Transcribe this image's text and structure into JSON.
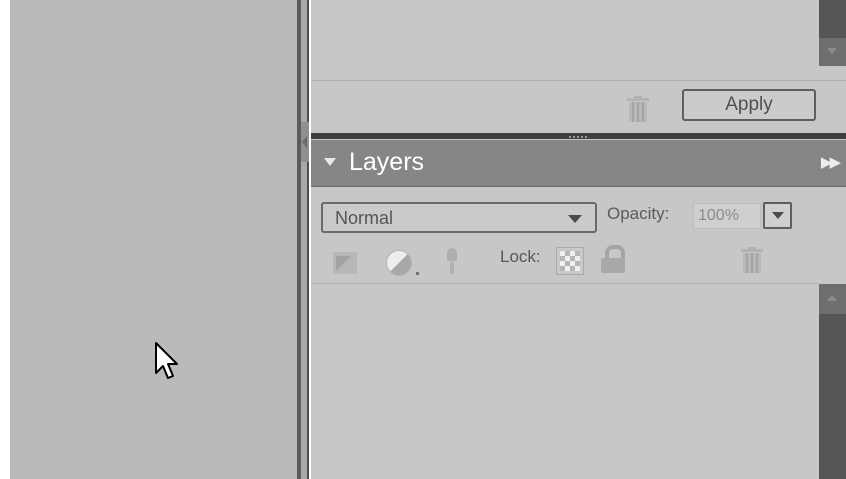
{
  "top_panel": {
    "apply_label": "Apply"
  },
  "layers_panel": {
    "title": "Layers",
    "blend_mode": "Normal",
    "opacity_label": "Opacity:",
    "opacity_value": "100%",
    "lock_label": "Lock:",
    "flyout_glyph": "▶▶"
  },
  "icons": [
    "delete-icon",
    "collapse-triangle-icon",
    "panel-menu-icon",
    "dropdown-arrow-icon",
    "new-layer-icon",
    "adjustment-layer-icon",
    "link-layers-icon",
    "lock-transparent-icon",
    "lock-all-icon",
    "trash-icon",
    "mouse-cursor-icon"
  ],
  "colors": {
    "panel_bg": "#c7c7c7",
    "header_bg": "#868686",
    "canvas_bg": "#bababa",
    "scroll_dark": "#555555"
  }
}
